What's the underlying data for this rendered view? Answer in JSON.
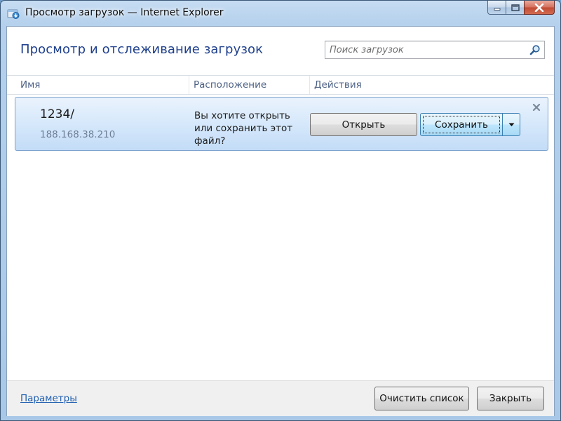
{
  "window": {
    "title": "Просмотр загрузок — Internet Explorer",
    "icon": "ie-download-icon"
  },
  "header": {
    "title": "Просмотр и отслеживание загрузок",
    "search_placeholder": "Поиск загрузок",
    "search_icon": "magnifier-icon"
  },
  "columns": {
    "name": "Имя",
    "location": "Расположение",
    "actions": "Действия"
  },
  "download": {
    "name": "1234/",
    "host": "188.168.38.210",
    "prompt": "Вы хотите открыть или сохранить этот файл?",
    "open_label": "Открыть",
    "save_label": "Сохранить"
  },
  "footer": {
    "options_link": "Параметры",
    "clear_label": "Очистить список",
    "close_label": "Закрыть"
  },
  "colors": {
    "title_blue": "#1e3f8c",
    "link_blue": "#1f5fb0",
    "item_border": "#7da2ce",
    "frame": "#a9c8e8"
  }
}
